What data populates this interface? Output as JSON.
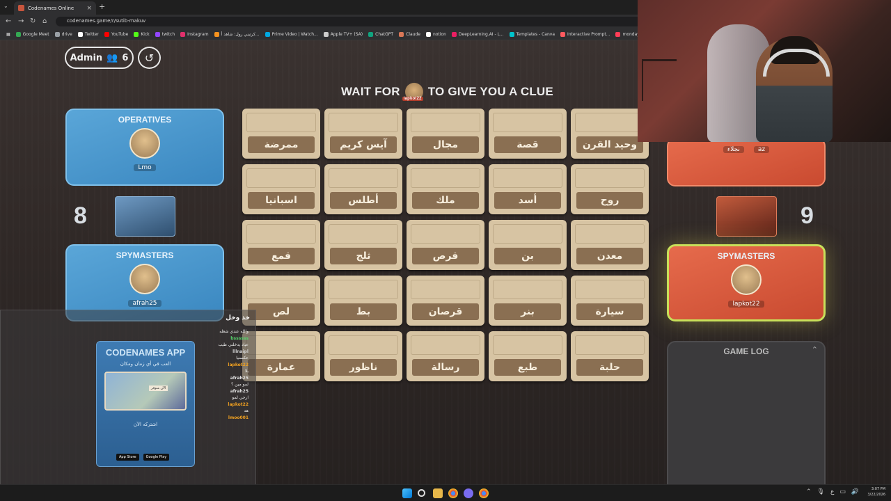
{
  "browser": {
    "tab_title": "Codenames Online",
    "url": "codenames.game/r/sutib-makuv",
    "bookmarks": [
      "Google Meet",
      "drive",
      "Twitter",
      "YouTube",
      "Kick",
      "twitch",
      "Instagram",
      "كرتيني رول: شاهد أ...",
      "Prime Video | Watch...",
      "Apple TV+ (SA)",
      "ChatGPT",
      "Claude",
      "notion",
      "DeepLearning.AI - L...",
      "Templates - Canva",
      "Interactive Prompt...",
      "monday.com | Out"
    ]
  },
  "header": {
    "admin_label": "Admin",
    "player_count": "6"
  },
  "clue_banner": {
    "prefix": "WAIT FOR",
    "suffix": "TO GIVE YOU A CLUE",
    "spymaster_tag": "lapkot22"
  },
  "blue_team": {
    "score": "8",
    "operatives_title": "OPERATIVES",
    "operatives": [
      "Lmo"
    ],
    "spymasters_title": "SPYMASTERS",
    "spymasters": [
      "afrah25"
    ]
  },
  "red_team": {
    "score": "9",
    "operatives": [
      "نجلاء",
      "az"
    ],
    "spymasters_title": "SPYMASTERS",
    "spymasters": [
      "lapkot22"
    ]
  },
  "board": [
    [
      "ممرضة",
      "آيس كريم",
      "مجال",
      "قصة",
      "وحيد القرن"
    ],
    [
      "اسبانيا",
      "أطلس",
      "ملك",
      "أسد",
      "روح"
    ],
    [
      "قمع",
      "ثلج",
      "قرص",
      "بن",
      "معدن"
    ],
    [
      "لص",
      "بط",
      "قرصان",
      "بنر",
      "سيارة"
    ],
    [
      "عمارة",
      "ناظور",
      "رسالة",
      "طبع",
      "حلبة"
    ]
  ],
  "game_log": {
    "title": "GAME LOG"
  },
  "chat": {
    "title": "خذ وخل",
    "messages": [
      {
        "user": "",
        "text": "والله عندي شغله"
      },
      {
        "user": "bssssss",
        "text": "عياد يدخلني طيب"
      },
      {
        "user": "lllnaipl",
        "text": "عكسنيا"
      },
      {
        "user": "lapkot22",
        "text": "بلا"
      },
      {
        "user": "afrah25",
        "text": "لمو مين ؟"
      },
      {
        "user": "afrah25",
        "text": "ارجي لمو"
      },
      {
        "user": "lapkot22",
        "text": "هه"
      },
      {
        "user": "lmoo001",
        "text": ""
      }
    ],
    "ad": {
      "title": "CODENAMES APP",
      "subtitle": "العب في أي زمان ومكان",
      "image_caption": "الآن متوفر",
      "cta": "اشتركه الآن",
      "store1": "App Store",
      "store2": "Google Play"
    }
  },
  "taskbar": {
    "time": "3:07 PM",
    "date": "3/22/2026",
    "lang": "ع"
  }
}
